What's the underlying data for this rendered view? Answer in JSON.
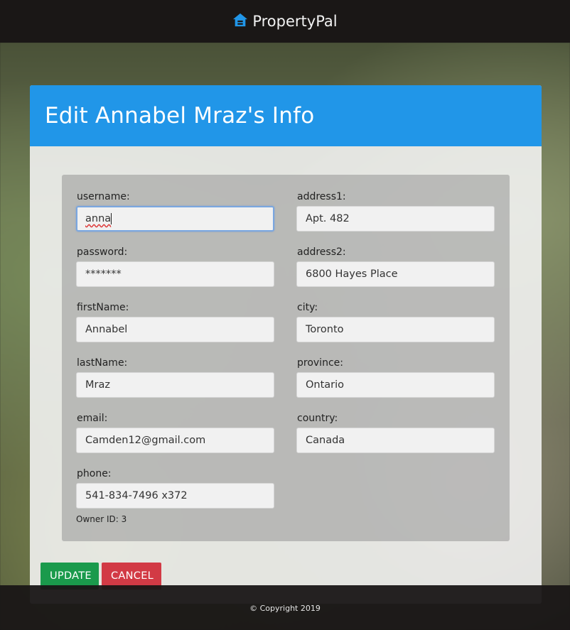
{
  "header": {
    "brand": "PropertyPal",
    "icon": "house-icon",
    "accent": "#2196e8"
  },
  "card": {
    "title": "Edit Annabel Mraz's Info"
  },
  "form": {
    "username": {
      "label": "username:",
      "value": "anna"
    },
    "password": {
      "label": "password:",
      "value": "*******"
    },
    "firstName": {
      "label": "firstName:",
      "value": "Annabel"
    },
    "lastName": {
      "label": "lastName:",
      "value": "Mraz"
    },
    "email": {
      "label": "email:",
      "value": "Camden12@gmail.com"
    },
    "phone": {
      "label": "phone:",
      "value": "541-834-7496 x372"
    },
    "address1": {
      "label": "address1:",
      "value": "Apt. 482"
    },
    "address2": {
      "label": "address2:",
      "value": "6800 Hayes Place"
    },
    "city": {
      "label": "city:",
      "value": "Toronto"
    },
    "province": {
      "label": "province:",
      "value": "Ontario"
    },
    "country": {
      "label": "country:",
      "value": "Canada"
    },
    "owner_id": "Owner ID: 3"
  },
  "buttons": {
    "update": "UPDATE",
    "cancel": "CANCEL",
    "update_color": "#1a9a4c",
    "cancel_color": "#d23a45"
  },
  "footer": {
    "copyright": "© Copyright 2019"
  }
}
